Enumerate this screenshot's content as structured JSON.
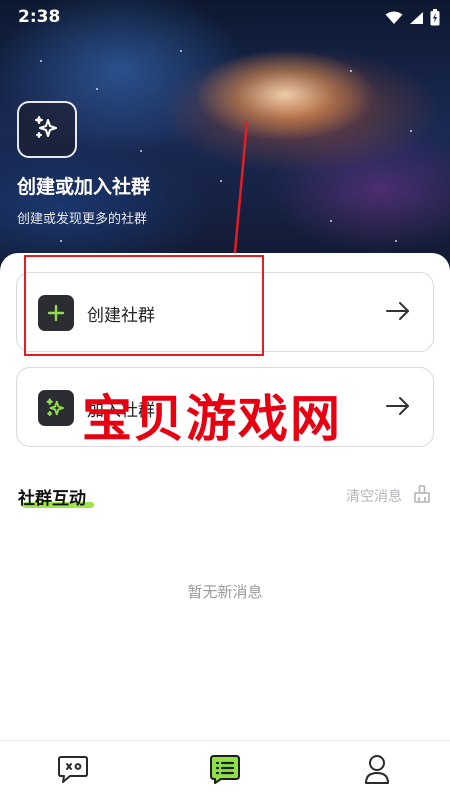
{
  "status_bar": {
    "time": "2:38",
    "icons": [
      "wifi-icon",
      "signal-icon",
      "battery-charging-icon"
    ]
  },
  "hero": {
    "icon": "sparkles-icon",
    "title": "创建或加入社群",
    "subtitle": "创建或发现更多的社群"
  },
  "actions": [
    {
      "label": "创建社群",
      "icon": "plus-icon",
      "arrow": "arrow-right-icon"
    },
    {
      "label": "加入社群",
      "icon": "sparkles-icon",
      "arrow": "arrow-right-icon"
    }
  ],
  "watermark": "宝贝游戏网",
  "interaction": {
    "title": "社群互动",
    "clear_label": "清空消息",
    "clear_icon": "broom-icon",
    "empty_text": "暂无新消息"
  },
  "bottom_nav": [
    {
      "icon": "chat-bubble-icon",
      "active": false
    },
    {
      "icon": "list-icon",
      "active": true
    },
    {
      "icon": "person-icon",
      "active": false
    }
  ],
  "colors": {
    "accent_green": "#9ee34a",
    "annotation_red": "#e51d20",
    "watermark_red": "#e60012",
    "card_icon_bg": "#2b2d33"
  }
}
